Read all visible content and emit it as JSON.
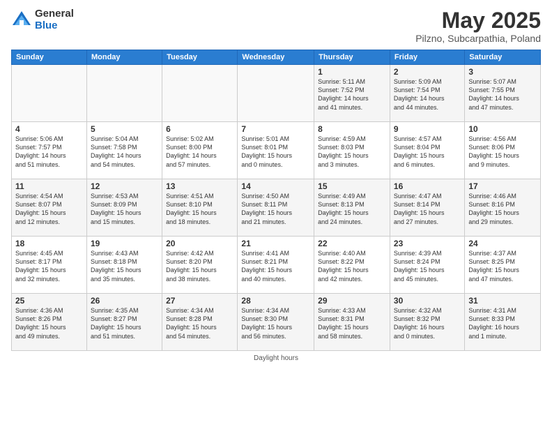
{
  "header": {
    "logo_general": "General",
    "logo_blue": "Blue",
    "title": "May 2025",
    "location": "Pilzno, Subcarpathia, Poland"
  },
  "days_of_week": [
    "Sunday",
    "Monday",
    "Tuesday",
    "Wednesday",
    "Thursday",
    "Friday",
    "Saturday"
  ],
  "weeks": [
    [
      {
        "num": "",
        "info": ""
      },
      {
        "num": "",
        "info": ""
      },
      {
        "num": "",
        "info": ""
      },
      {
        "num": "",
        "info": ""
      },
      {
        "num": "1",
        "info": "Sunrise: 5:11 AM\nSunset: 7:52 PM\nDaylight: 14 hours\nand 41 minutes."
      },
      {
        "num": "2",
        "info": "Sunrise: 5:09 AM\nSunset: 7:54 PM\nDaylight: 14 hours\nand 44 minutes."
      },
      {
        "num": "3",
        "info": "Sunrise: 5:07 AM\nSunset: 7:55 PM\nDaylight: 14 hours\nand 47 minutes."
      }
    ],
    [
      {
        "num": "4",
        "info": "Sunrise: 5:06 AM\nSunset: 7:57 PM\nDaylight: 14 hours\nand 51 minutes."
      },
      {
        "num": "5",
        "info": "Sunrise: 5:04 AM\nSunset: 7:58 PM\nDaylight: 14 hours\nand 54 minutes."
      },
      {
        "num": "6",
        "info": "Sunrise: 5:02 AM\nSunset: 8:00 PM\nDaylight: 14 hours\nand 57 minutes."
      },
      {
        "num": "7",
        "info": "Sunrise: 5:01 AM\nSunset: 8:01 PM\nDaylight: 15 hours\nand 0 minutes."
      },
      {
        "num": "8",
        "info": "Sunrise: 4:59 AM\nSunset: 8:03 PM\nDaylight: 15 hours\nand 3 minutes."
      },
      {
        "num": "9",
        "info": "Sunrise: 4:57 AM\nSunset: 8:04 PM\nDaylight: 15 hours\nand 6 minutes."
      },
      {
        "num": "10",
        "info": "Sunrise: 4:56 AM\nSunset: 8:06 PM\nDaylight: 15 hours\nand 9 minutes."
      }
    ],
    [
      {
        "num": "11",
        "info": "Sunrise: 4:54 AM\nSunset: 8:07 PM\nDaylight: 15 hours\nand 12 minutes."
      },
      {
        "num": "12",
        "info": "Sunrise: 4:53 AM\nSunset: 8:09 PM\nDaylight: 15 hours\nand 15 minutes."
      },
      {
        "num": "13",
        "info": "Sunrise: 4:51 AM\nSunset: 8:10 PM\nDaylight: 15 hours\nand 18 minutes."
      },
      {
        "num": "14",
        "info": "Sunrise: 4:50 AM\nSunset: 8:11 PM\nDaylight: 15 hours\nand 21 minutes."
      },
      {
        "num": "15",
        "info": "Sunrise: 4:49 AM\nSunset: 8:13 PM\nDaylight: 15 hours\nand 24 minutes."
      },
      {
        "num": "16",
        "info": "Sunrise: 4:47 AM\nSunset: 8:14 PM\nDaylight: 15 hours\nand 27 minutes."
      },
      {
        "num": "17",
        "info": "Sunrise: 4:46 AM\nSunset: 8:16 PM\nDaylight: 15 hours\nand 29 minutes."
      }
    ],
    [
      {
        "num": "18",
        "info": "Sunrise: 4:45 AM\nSunset: 8:17 PM\nDaylight: 15 hours\nand 32 minutes."
      },
      {
        "num": "19",
        "info": "Sunrise: 4:43 AM\nSunset: 8:18 PM\nDaylight: 15 hours\nand 35 minutes."
      },
      {
        "num": "20",
        "info": "Sunrise: 4:42 AM\nSunset: 8:20 PM\nDaylight: 15 hours\nand 38 minutes."
      },
      {
        "num": "21",
        "info": "Sunrise: 4:41 AM\nSunset: 8:21 PM\nDaylight: 15 hours\nand 40 minutes."
      },
      {
        "num": "22",
        "info": "Sunrise: 4:40 AM\nSunset: 8:22 PM\nDaylight: 15 hours\nand 42 minutes."
      },
      {
        "num": "23",
        "info": "Sunrise: 4:39 AM\nSunset: 8:24 PM\nDaylight: 15 hours\nand 45 minutes."
      },
      {
        "num": "24",
        "info": "Sunrise: 4:37 AM\nSunset: 8:25 PM\nDaylight: 15 hours\nand 47 minutes."
      }
    ],
    [
      {
        "num": "25",
        "info": "Sunrise: 4:36 AM\nSunset: 8:26 PM\nDaylight: 15 hours\nand 49 minutes."
      },
      {
        "num": "26",
        "info": "Sunrise: 4:35 AM\nSunset: 8:27 PM\nDaylight: 15 hours\nand 51 minutes."
      },
      {
        "num": "27",
        "info": "Sunrise: 4:34 AM\nSunset: 8:28 PM\nDaylight: 15 hours\nand 54 minutes."
      },
      {
        "num": "28",
        "info": "Sunrise: 4:34 AM\nSunset: 8:30 PM\nDaylight: 15 hours\nand 56 minutes."
      },
      {
        "num": "29",
        "info": "Sunrise: 4:33 AM\nSunset: 8:31 PM\nDaylight: 15 hours\nand 58 minutes."
      },
      {
        "num": "30",
        "info": "Sunrise: 4:32 AM\nSunset: 8:32 PM\nDaylight: 16 hours\nand 0 minutes."
      },
      {
        "num": "31",
        "info": "Sunrise: 4:31 AM\nSunset: 8:33 PM\nDaylight: 16 hours\nand 1 minute."
      }
    ]
  ],
  "footer": "Daylight hours"
}
